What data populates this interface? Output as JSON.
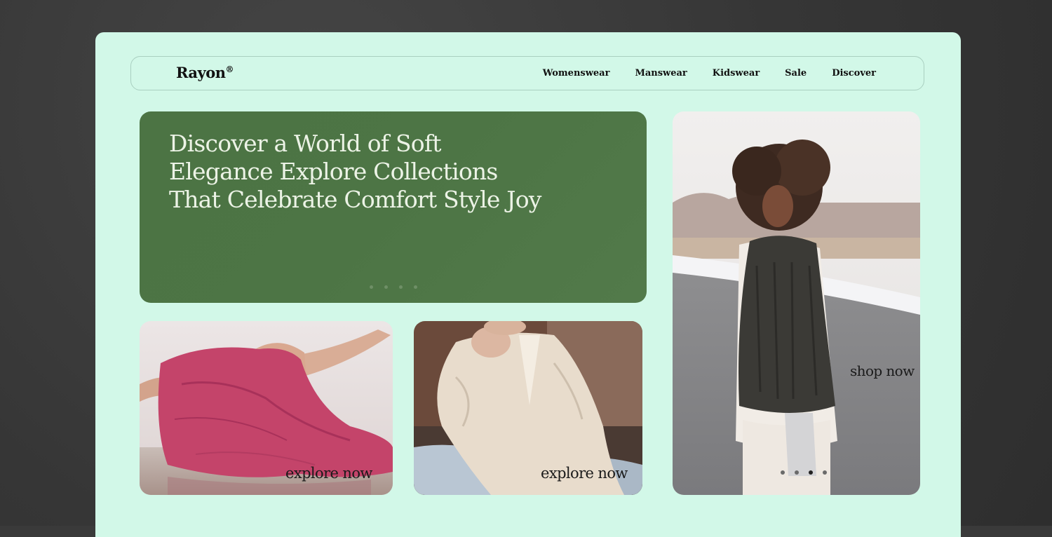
{
  "brand": {
    "name": "Rayon",
    "mark": "®"
  },
  "nav": {
    "items": [
      {
        "label": "Womenswear"
      },
      {
        "label": "Manswear"
      },
      {
        "label": "Kidswear"
      },
      {
        "label": "Sale"
      },
      {
        "label": "Discover"
      }
    ]
  },
  "hero": {
    "title_line1": "Discover a World of Soft",
    "title_line2": "Elegance Explore Collections",
    "title_line3": "That Celebrate Comfort Style Joy",
    "slide_count": 4
  },
  "cards": {
    "card1_cta": "explore now",
    "card2_cta": "explore now",
    "card3_cta": "shop now",
    "card3_slide_count": 4,
    "card3_active_slide": 3
  },
  "colors": {
    "page_bg": "#d2f8e8",
    "hero_bg": "#4d7545",
    "backdrop": "#3a3a3a"
  }
}
